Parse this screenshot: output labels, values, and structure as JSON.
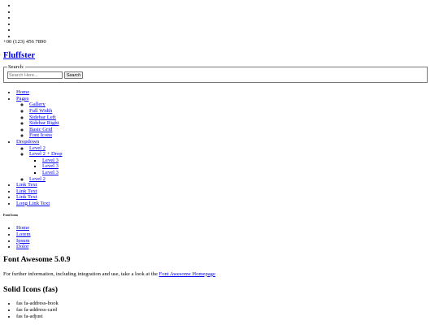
{
  "header": {
    "social_items": [
      "",
      "",
      "",
      "",
      "",
      ""
    ],
    "phone": "+00 (123) 456 7890",
    "site_title": "Fluffster"
  },
  "search": {
    "legend": "Search:",
    "placeholder": "Search Here...",
    "button_label": "Search"
  },
  "main_menu": {
    "home": "Home",
    "pages": {
      "label": "Pages",
      "items": [
        "Gallery",
        "Full Width",
        "Sidebar Left",
        "Sidebar Right",
        "Basic Grid",
        "Font Icons"
      ]
    },
    "dropdown": {
      "label": "Dropdown",
      "level2_a": "Level 2",
      "level2_drop": "Level 2 + Drop",
      "level3": [
        "Level 3",
        "Level 3",
        "Level 3"
      ],
      "level2_b": "Level 2"
    },
    "links": [
      "Link Text",
      "Link Text",
      "Link Text",
      "Long Link Text"
    ]
  },
  "font_icons_heading": "Font Icons",
  "breadcrumb": [
    "Home",
    "Lorem",
    "Ipsum",
    "Dolor"
  ],
  "content": {
    "fa_heading": "Font Awesome 5.0.9",
    "para_text": "For further information, including integration and use, take a look at the ",
    "para_link": "Font Awesome Homepage",
    "solid_heading": "Solid Icons (fas)",
    "solid_items": [
      "fas fa-address-book",
      "fas fa-address-card",
      "fas fa-adjust"
    ]
  }
}
